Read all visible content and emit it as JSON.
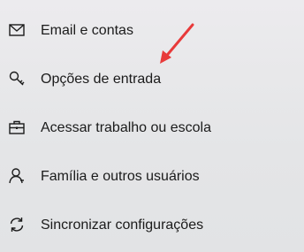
{
  "menu": {
    "items": [
      {
        "label": "Email e contas",
        "icon": "mail-icon"
      },
      {
        "label": "Opções de entrada",
        "icon": "key-icon"
      },
      {
        "label": "Acessar trabalho ou escola",
        "icon": "briefcase-icon"
      },
      {
        "label": "Família e outros usuários",
        "icon": "person-icon"
      },
      {
        "label": "Sincronizar configurações",
        "icon": "sync-icon"
      }
    ]
  },
  "annotation": {
    "arrow_color": "#e83a3a"
  }
}
